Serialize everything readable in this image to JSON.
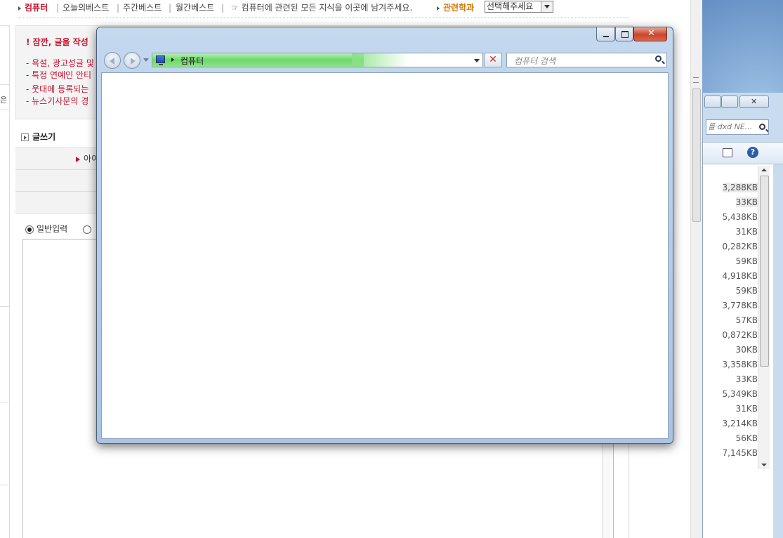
{
  "topnav": {
    "items": [
      {
        "label": "컴퓨터"
      },
      {
        "label": "오늘의베스트"
      },
      {
        "label": "주간베스트"
      },
      {
        "label": "월간베스트"
      }
    ],
    "tagline": "☞ 컴퓨터에 관련된 모든 지식을 이곳에 남겨주세요.",
    "related_label": "관련학과",
    "related_select": "선택해주세요"
  },
  "left_strip_char": "은",
  "notice": {
    "title": "! 잠깐, 글을 작성",
    "lines": [
      "- 욕설, 광고성글 및",
      "- 특정 연예인 안티",
      "- 웃대에 등록되는",
      "- 뉴스기사문의 경"
    ]
  },
  "write": {
    "header": "글쓰기",
    "id_label": "아이디",
    "radio_normal": "일반입력"
  },
  "explorer": {
    "breadcrumb": "컴퓨터",
    "search_placeholder": "컴퓨터 검색",
    "stop_glyph": "✕",
    "close_glyph": "✕",
    "address_progress": 0.64
  },
  "bg_explorer": {
    "search_text": "dxd NE...",
    "search_prefix": "를",
    "help_glyph": "?",
    "sizes": [
      "3,288KB",
      "33KB",
      "5,438KB",
      "31KB",
      "0,282KB",
      "59KB",
      "4,918KB",
      "59KB",
      "3,778KB",
      "57KB",
      "0,872KB",
      "30KB",
      "3,358KB",
      "33KB",
      "5,349KB",
      "31KB",
      "3,214KB",
      "56KB",
      "7,145KB"
    ]
  }
}
